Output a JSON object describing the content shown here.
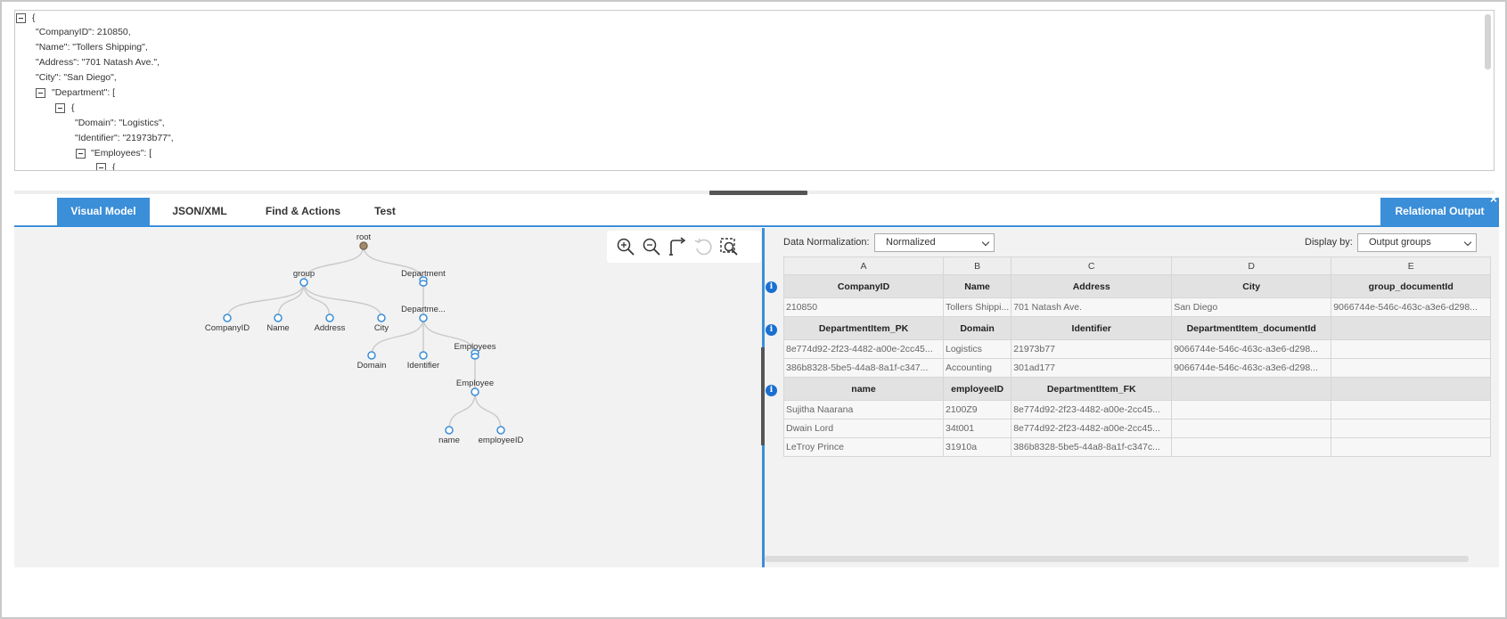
{
  "json_viewer": {
    "lines": [
      {
        "text": "{",
        "toggle": true
      },
      {
        "text": "\"CompanyID\": 210850,",
        "toggle": false
      },
      {
        "text": "\"Name\": \"Tollers Shipping\",",
        "toggle": false
      },
      {
        "text": "\"Address\": \"701 Natash Ave.\",",
        "toggle": false
      },
      {
        "text": "\"City\": \"San Diego\",",
        "toggle": false
      },
      {
        "text": "\"Department\": [",
        "toggle": true
      },
      {
        "text": "{",
        "toggle": true
      },
      {
        "text": "\"Domain\": \"Logistics\",",
        "toggle": false
      },
      {
        "text": "\"Identifier\": \"21973b77\",",
        "toggle": false
      },
      {
        "text": "\"Employees\": [",
        "toggle": true
      },
      {
        "text": "{",
        "toggle": true
      }
    ]
  },
  "tabs": [
    {
      "label": "Visual Model",
      "active": true
    },
    {
      "label": "JSON/XML",
      "active": false
    },
    {
      "label": "Find & Actions",
      "active": false
    },
    {
      "label": "Test",
      "active": false
    }
  ],
  "relational_output_tab": {
    "label": "Relational Output",
    "close": "×"
  },
  "toolbar": {
    "zoom_in": "zoom-in-icon",
    "zoom_out": "zoom-out-icon",
    "layout": "layout-connector-icon",
    "undo": "undo-icon",
    "fit": "fit-to-screen-icon"
  },
  "tree": {
    "nodes": [
      {
        "id": "root",
        "label": "root",
        "kind": "root"
      },
      {
        "id": "group",
        "label": "group",
        "kind": "group"
      },
      {
        "id": "department",
        "label": "Department",
        "kind": "array"
      },
      {
        "id": "companyid",
        "label": "CompanyID",
        "kind": "leaf"
      },
      {
        "id": "name",
        "label": "Name",
        "kind": "leaf"
      },
      {
        "id": "address",
        "label": "Address",
        "kind": "leaf"
      },
      {
        "id": "city",
        "label": "City",
        "kind": "leaf"
      },
      {
        "id": "departme",
        "label": "Departme...",
        "kind": "group"
      },
      {
        "id": "domain",
        "label": "Domain",
        "kind": "leaf"
      },
      {
        "id": "identifier",
        "label": "Identifier",
        "kind": "leaf"
      },
      {
        "id": "employees",
        "label": "Employees",
        "kind": "array"
      },
      {
        "id": "employee",
        "label": "Employee",
        "kind": "group"
      },
      {
        "id": "ename",
        "label": "name",
        "kind": "leaf"
      },
      {
        "id": "employeeid",
        "label": "employeeID",
        "kind": "leaf"
      }
    ]
  },
  "relational": {
    "normalization_label": "Data Normalization:",
    "normalization_value": "Normalized",
    "display_label": "Display by:",
    "display_value": "Output groups",
    "columns": [
      "A",
      "B",
      "C",
      "D",
      "E"
    ],
    "info_icon": "i",
    "groups": [
      {
        "headers": [
          "CompanyID",
          "Name",
          "Address",
          "City",
          "group_documentId"
        ],
        "rows": [
          [
            "210850",
            "Tollers Shippi...",
            "701 Natash Ave.",
            "San Diego",
            "9066744e-546c-463c-a3e6-d298..."
          ]
        ]
      },
      {
        "headers": [
          "DepartmentItem_PK",
          "Domain",
          "Identifier",
          "DepartmentItem_documentId",
          ""
        ],
        "rows": [
          [
            "8e774d92-2f23-4482-a00e-2cc45...",
            "Logistics",
            "21973b77",
            "9066744e-546c-463c-a3e6-d298...",
            ""
          ],
          [
            "386b8328-5be5-44a8-8a1f-c347...",
            "Accounting",
            "301ad177",
            "9066744e-546c-463c-a3e6-d298...",
            ""
          ]
        ]
      },
      {
        "headers": [
          "name",
          "employeeID",
          "DepartmentItem_FK",
          "",
          ""
        ],
        "rows": [
          [
            "Sujitha Naarana",
            "2100Z9",
            "8e774d92-2f23-4482-a00e-2cc45...",
            "",
            ""
          ],
          [
            "Dwain Lord",
            "34t001",
            "8e774d92-2f23-4482-a00e-2cc45...",
            "",
            ""
          ],
          [
            "LeTroy Prince",
            "31910a",
            "386b8328-5be5-44a8-8a1f-c347c...",
            "",
            ""
          ]
        ]
      }
    ]
  }
}
